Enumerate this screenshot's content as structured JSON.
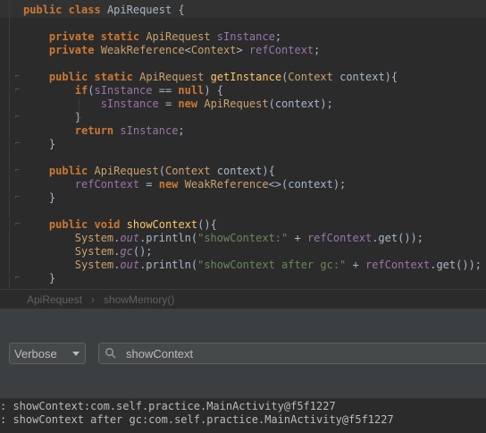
{
  "editor": {
    "lines": [
      {
        "segs": [
          [
            "kw",
            "public"
          ],
          [
            "plain",
            " "
          ],
          [
            "kw",
            "class"
          ],
          [
            "plain",
            " ApiRequest {"
          ]
        ]
      },
      {
        "segs": []
      },
      {
        "segs": [
          [
            "plain",
            "    "
          ],
          [
            "kw",
            "private"
          ],
          [
            "plain",
            " "
          ],
          [
            "kw",
            "static"
          ],
          [
            "plain",
            " "
          ],
          [
            "tp",
            "ApiRequest"
          ],
          [
            "plain",
            " "
          ],
          [
            "fld",
            "sInstance"
          ],
          [
            "plain",
            ";"
          ]
        ]
      },
      {
        "segs": [
          [
            "plain",
            "    "
          ],
          [
            "kw",
            "private"
          ],
          [
            "plain",
            " "
          ],
          [
            "tp",
            "WeakReference"
          ],
          [
            "plain",
            "<"
          ],
          [
            "tp",
            "Context"
          ],
          [
            "plain",
            "> "
          ],
          [
            "fld",
            "refContext"
          ],
          [
            "plain",
            ";"
          ]
        ]
      },
      {
        "segs": []
      },
      {
        "segs": [
          [
            "plain",
            "    "
          ],
          [
            "kw",
            "public"
          ],
          [
            "plain",
            " "
          ],
          [
            "kw",
            "static"
          ],
          [
            "plain",
            " "
          ],
          [
            "tp",
            "ApiRequest"
          ],
          [
            "plain",
            " "
          ],
          [
            "mth",
            "getInstance"
          ],
          [
            "plain",
            "("
          ],
          [
            "tp",
            "Context"
          ],
          [
            "plain",
            " context){"
          ]
        ]
      },
      {
        "segs": [
          [
            "plain",
            "        "
          ],
          [
            "kw",
            "if"
          ],
          [
            "plain",
            "("
          ],
          [
            "fld",
            "sInstance"
          ],
          [
            "plain",
            " == "
          ],
          [
            "kw",
            "null"
          ],
          [
            "plain",
            ") {"
          ]
        ]
      },
      {
        "segs": [
          [
            "plain",
            "            "
          ],
          [
            "fld",
            "sInstance"
          ],
          [
            "plain",
            " = "
          ],
          [
            "kw",
            "new"
          ],
          [
            "plain",
            " "
          ],
          [
            "tp",
            "ApiRequest"
          ],
          [
            "plain",
            "(context);"
          ]
        ]
      },
      {
        "segs": [
          [
            "plain",
            "        }"
          ]
        ]
      },
      {
        "segs": [
          [
            "plain",
            "        "
          ],
          [
            "kw",
            "return"
          ],
          [
            "plain",
            " "
          ],
          [
            "fld",
            "sInstance"
          ],
          [
            "plain",
            ";"
          ]
        ]
      },
      {
        "segs": [
          [
            "plain",
            "    }"
          ]
        ]
      },
      {
        "segs": []
      },
      {
        "segs": [
          [
            "plain",
            "    "
          ],
          [
            "kw",
            "public"
          ],
          [
            "plain",
            " "
          ],
          [
            "tp",
            "ApiRequest"
          ],
          [
            "plain",
            "("
          ],
          [
            "tp",
            "Context"
          ],
          [
            "plain",
            " context){"
          ]
        ]
      },
      {
        "segs": [
          [
            "plain",
            "        "
          ],
          [
            "fld",
            "refContext"
          ],
          [
            "plain",
            " = "
          ],
          [
            "kw",
            "new"
          ],
          [
            "plain",
            " "
          ],
          [
            "tp",
            "WeakReference"
          ],
          [
            "plain",
            "<>(context);"
          ]
        ]
      },
      {
        "segs": [
          [
            "plain",
            "    }"
          ]
        ]
      },
      {
        "segs": []
      },
      {
        "segs": [
          [
            "plain",
            "    "
          ],
          [
            "kw",
            "public"
          ],
          [
            "plain",
            " "
          ],
          [
            "kw",
            "void"
          ],
          [
            "plain",
            " "
          ],
          [
            "mth",
            "showContext"
          ],
          [
            "plain",
            "(){"
          ]
        ]
      },
      {
        "segs": [
          [
            "plain",
            "        "
          ],
          [
            "tp",
            "System"
          ],
          [
            "plain",
            "."
          ],
          [
            "ital",
            "out"
          ],
          [
            "plain",
            ".println("
          ],
          [
            "str",
            "\"showContext:\""
          ],
          [
            "plain",
            " + "
          ],
          [
            "fld",
            "refContext"
          ],
          [
            "plain",
            ".get());"
          ]
        ]
      },
      {
        "segs": [
          [
            "plain",
            "        "
          ],
          [
            "tp",
            "System"
          ],
          [
            "plain",
            "."
          ],
          [
            "ital",
            "gc"
          ],
          [
            "plain",
            "();"
          ]
        ]
      },
      {
        "segs": [
          [
            "plain",
            "        "
          ],
          [
            "tp",
            "System"
          ],
          [
            "plain",
            "."
          ],
          [
            "ital",
            "out"
          ],
          [
            "plain",
            ".println("
          ],
          [
            "str",
            "\"showContext after gc:\""
          ],
          [
            "plain",
            " + "
          ],
          [
            "fld",
            "refContext"
          ],
          [
            "plain",
            ".get());"
          ]
        ]
      },
      {
        "segs": [
          [
            "plain",
            "    }"
          ]
        ]
      }
    ]
  },
  "breadcrumb": {
    "class_name": "ApiRequest",
    "separator": "›",
    "method_name": "showMemory()"
  },
  "logcat": {
    "level": "Verbose",
    "search_value": "showContext",
    "lines": [
      ": showContext:com.self.practice.MainActivity@f5f1227",
      ": showContext after gc:com.self.practice.MainActivity@f5f1227"
    ]
  },
  "colors": {
    "keyword": "#cc7832",
    "type": "#c9a26d",
    "field": "#9876aa",
    "method": "#ffc66d",
    "string": "#6a8759",
    "text": "#a9b7c6",
    "background": "#2b2b2b",
    "panel": "#3c3f41"
  }
}
